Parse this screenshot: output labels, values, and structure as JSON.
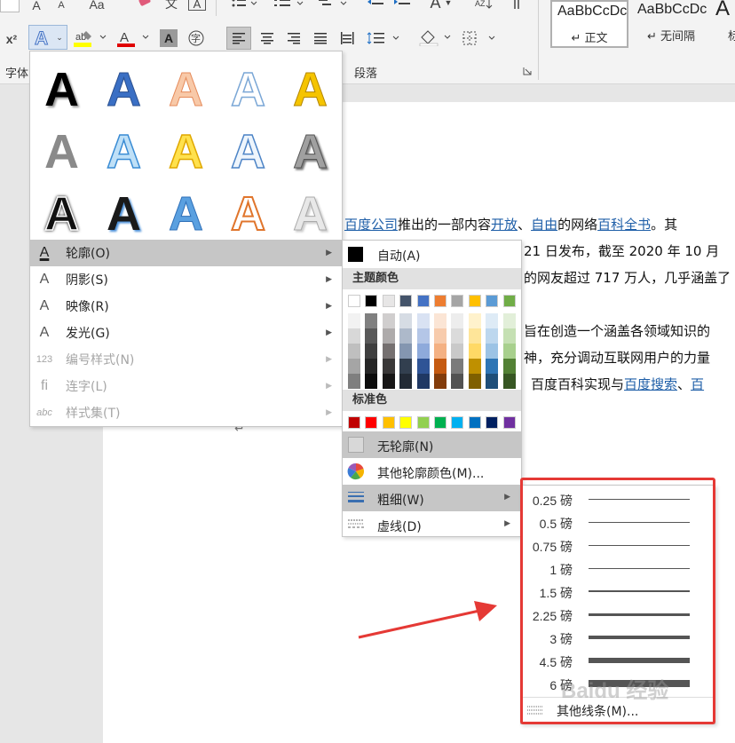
{
  "ribbon": {
    "font_row1": [
      "A",
      "A",
      "Aa",
      "文",
      "A"
    ],
    "font_row2_labels": [
      "x²",
      "A",
      "ab",
      "A",
      "A",
      "字"
    ],
    "group_font": "字体",
    "group_paragraph": "段落",
    "styles": [
      {
        "preview": "AaBbCcDc",
        "name": "↵ 正文"
      },
      {
        "preview": "AaBbCcDc",
        "name": "↵ 无间隔"
      },
      {
        "preview": "A",
        "name": "标"
      }
    ]
  },
  "document": {
    "lines": [
      {
        "parts": [
          {
            "text": "百度公司",
            "link": true
          },
          {
            "text": "推出的一部内容",
            "link": false
          },
          {
            "text": "开放",
            "link": true
          },
          {
            "text": "、",
            "link": false
          },
          {
            "text": "自由",
            "link": true
          },
          {
            "text": "的网络",
            "link": false
          },
          {
            "text": "百科全书",
            "link": true
          },
          {
            "text": "。其",
            "link": false
          }
        ]
      },
      {
        "parts": [
          {
            "text": "21 日发布，截至 2020 年 10 月",
            "link": false
          }
        ]
      },
      {
        "parts": [
          {
            "text": "的网友超过 717 万人，几乎涵盖了",
            "link": false
          }
        ]
      },
      {
        "parts": [
          {
            "text": "旨在创造一个涵盖各领域知识的",
            "link": false
          }
        ]
      },
      {
        "parts": [
          {
            "text": "神，充分调动互联网用户的力量",
            "link": false
          }
        ]
      },
      {
        "parts": [
          {
            "text": "百度百科实现与",
            "link": false
          },
          {
            "text": "百度搜索",
            "link": true
          },
          {
            "text": "、",
            "link": false
          },
          {
            "text": "百",
            "link": true
          }
        ]
      }
    ],
    "return_mark": "↵"
  },
  "text_effects_menu": {
    "items": [
      {
        "label": "轮廓(O)",
        "icon": "text-outline-icon",
        "disabled": false,
        "highlighted": true
      },
      {
        "label": "阴影(S)",
        "icon": "text-shadow-icon",
        "disabled": false
      },
      {
        "label": "映像(R)",
        "icon": "text-reflection-icon",
        "disabled": false
      },
      {
        "label": "发光(G)",
        "icon": "text-glow-icon",
        "disabled": false
      },
      {
        "label": "编号样式(N)",
        "icon": "number-style-icon",
        "disabled": true
      },
      {
        "label": "连字(L)",
        "icon": "ligature-icon",
        "disabled": true
      },
      {
        "label": "样式集(T)",
        "icon": "stylistic-set-icon",
        "disabled": true
      }
    ],
    "item_glyphs": [
      "A",
      "A",
      "A",
      "A",
      "123",
      "fi",
      "abc"
    ]
  },
  "outline_menu": {
    "auto_label": "自动(A)",
    "theme_header": "主题颜色",
    "theme_colors": [
      "#ffffff",
      "#000000",
      "#e7e6e6",
      "#44546a",
      "#4472c4",
      "#ed7d31",
      "#a5a5a5",
      "#ffc000",
      "#5b9bd5",
      "#70ad47"
    ],
    "theme_shades": [
      [
        "#f2f2f2",
        "#808080",
        "#d0cece",
        "#d6dce4",
        "#d9e2f3",
        "#fbe5d5",
        "#ededed",
        "#fff2cc",
        "#deebf6",
        "#e2efd9"
      ],
      [
        "#d8d8d8",
        "#595959",
        "#aeabab",
        "#adb9ca",
        "#b4c6e7",
        "#f7cbac",
        "#dbdbdb",
        "#fee599",
        "#bdd7ee",
        "#c5e0b3"
      ],
      [
        "#bfbfbf",
        "#3f3f3f",
        "#757070",
        "#8496b0",
        "#8eaadb",
        "#f4b183",
        "#c9c9c9",
        "#ffd965",
        "#9cc3e5",
        "#a8d08d"
      ],
      [
        "#a5a5a5",
        "#262626",
        "#3a3838",
        "#323f4f",
        "#2f5496",
        "#c55a11",
        "#7b7b7b",
        "#bf9000",
        "#2e75b5",
        "#538135"
      ],
      [
        "#7f7f7f",
        "#0c0c0c",
        "#171616",
        "#222a35",
        "#1f3864",
        "#833c0b",
        "#525252",
        "#7f6000",
        "#1e4e79",
        "#375623"
      ]
    ],
    "standard_header": "标准色",
    "standard_colors": [
      "#c00000",
      "#ff0000",
      "#ffc000",
      "#ffff00",
      "#92d050",
      "#00b050",
      "#00b0f0",
      "#0070c0",
      "#002060",
      "#7030a0"
    ],
    "no_outline_label": "无轮廓(N)",
    "more_colors_label": "其他轮廓颜色(M)...",
    "weight_label": "粗细(W)",
    "dash_label": "虚线(D)"
  },
  "weight_menu": {
    "items": [
      {
        "label": "0.25 磅",
        "weight_pt": 0.25
      },
      {
        "label": "0.5 磅",
        "weight_pt": 0.5
      },
      {
        "label": "0.75 磅",
        "weight_pt": 0.75
      },
      {
        "label": "1 磅",
        "weight_pt": 1
      },
      {
        "label": "1.5 磅",
        "weight_pt": 1.5
      },
      {
        "label": "2.25 磅",
        "weight_pt": 2.25
      },
      {
        "label": "3 磅",
        "weight_pt": 3
      },
      {
        "label": "4.5 磅",
        "weight_pt": 4.5
      },
      {
        "label": "6 磅",
        "weight_pt": 6
      }
    ],
    "more_lines_label": "其他线条(M)...",
    "highlight_color": "#e53935"
  },
  "watermark": "Baidu 经验"
}
